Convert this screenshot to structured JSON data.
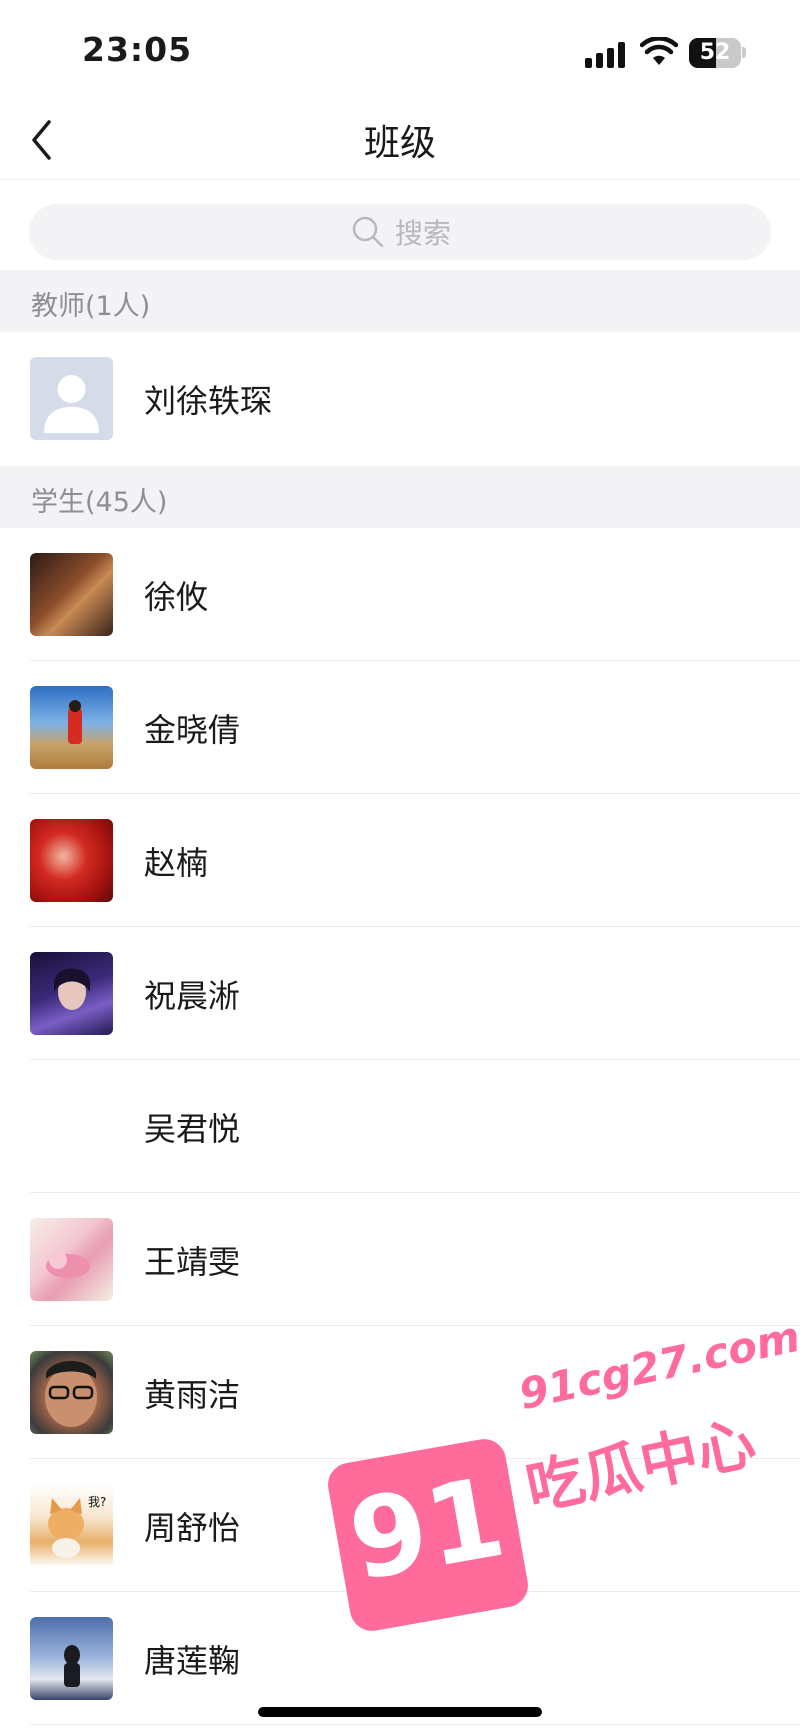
{
  "status_bar": {
    "time": "23:05",
    "battery_level": "52",
    "icons": [
      "signal-icon",
      "wifi-icon",
      "battery-icon"
    ]
  },
  "nav": {
    "title": "班级",
    "back_icon": "chevron-left-icon"
  },
  "search": {
    "placeholder": "搜索",
    "icon": "search-icon"
  },
  "sections": {
    "teachers": {
      "title": "教师(1人)",
      "members": [
        {
          "name": "刘徐轶琛",
          "avatar": "default-avatar-icon"
        }
      ]
    },
    "students": {
      "title": "学生(45人)",
      "members": [
        {
          "name": "徐攸"
        },
        {
          "name": "金晓倩"
        },
        {
          "name": "赵楠"
        },
        {
          "name": "祝晨淅"
        },
        {
          "name": "吴君悦"
        },
        {
          "name": "王靖雯"
        },
        {
          "name": "黄雨洁"
        },
        {
          "name": "周舒怡",
          "avatar_caption": "我?"
        },
        {
          "name": "唐莲鞠"
        }
      ]
    }
  },
  "watermark": {
    "url": "91cg27.com",
    "label": "吃瓜中心",
    "badge": "91"
  },
  "colors": {
    "section_bg": "#f3f3f5",
    "section_text": "#8e8e93",
    "watermark": "#ff6b9a"
  }
}
